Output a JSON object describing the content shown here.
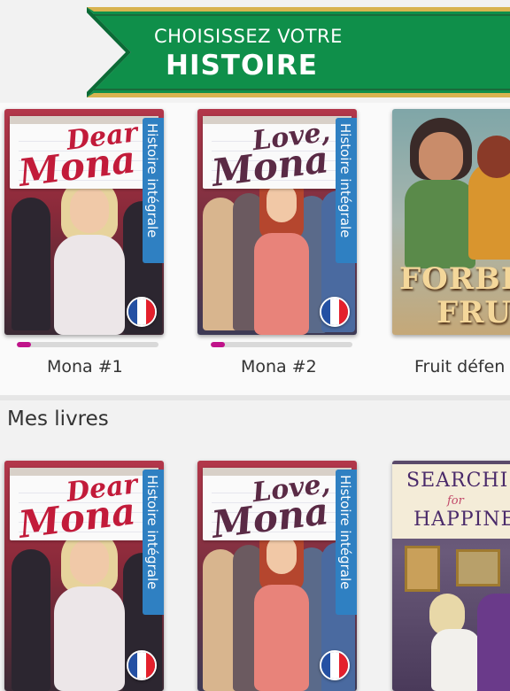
{
  "banner": {
    "line1": "CHOISISSEZ VOTRE",
    "line2": "HISTOIRE",
    "color": "#0f8f4a"
  },
  "featured": {
    "books": [
      {
        "title": "Mona #1",
        "logo_small": "Dear",
        "logo_big": "Mona",
        "tab": "Histoire intégrale",
        "progress": 0.1,
        "flag": "france-flag-icon"
      },
      {
        "title": "Mona #2",
        "logo_small": "Love,",
        "logo_big": "Mona",
        "tab": "Histoire intégrale",
        "progress": 0.1,
        "flag": "france-flag-icon"
      },
      {
        "title": "Fruit défen",
        "logo_text_1": "FORBIDD",
        "logo_text_2": "FRUI"
      }
    ]
  },
  "my_books": {
    "heading": "Mes livres",
    "books": [
      {
        "logo_small": "Dear",
        "logo_big": "Mona",
        "tab": "Histoire intégrale",
        "flag": "france-flag-icon"
      },
      {
        "logo_small": "Love,",
        "logo_big": "Mona",
        "tab": "Histoire intégrale",
        "flag": "france-flag-icon"
      },
      {
        "logo_text_1": "SEARCHI",
        "logo_text_2": "for",
        "logo_text_3": "HAPPINE"
      }
    ]
  }
}
